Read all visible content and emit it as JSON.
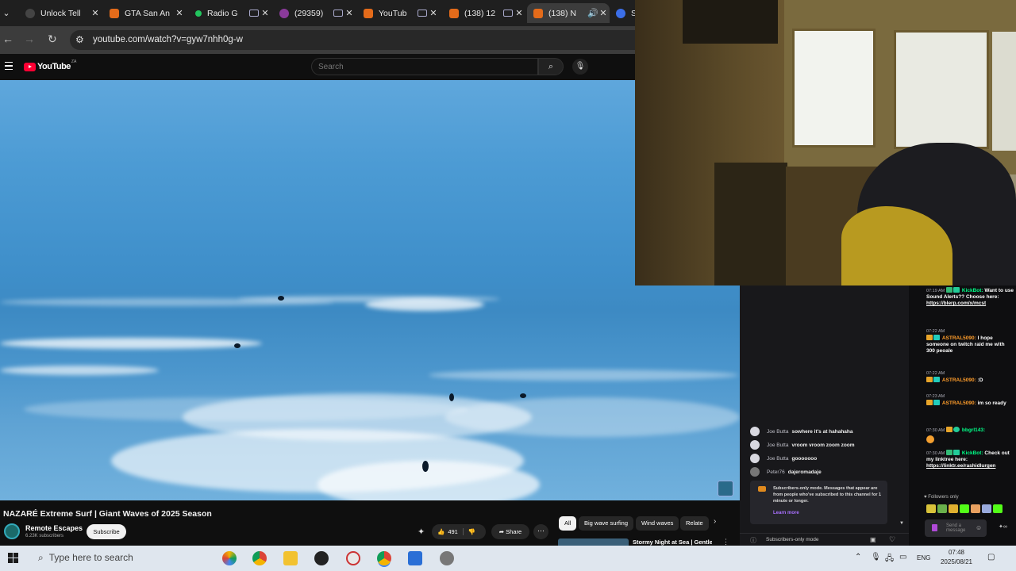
{
  "browser": {
    "tabs": [
      {
        "label": "Unlock Tell",
        "favicon": "circle-dark",
        "active": false
      },
      {
        "label": "GTA San An",
        "favicon": "youtube",
        "active": false
      },
      {
        "label": "Radio G",
        "favicon": "green-dot",
        "active": false
      },
      {
        "label": "(29359)",
        "favicon": "avatar",
        "active": false
      },
      {
        "label": "YouTub",
        "favicon": "youtube",
        "active": false
      },
      {
        "label": "(138) 12",
        "favicon": "youtube",
        "active": false
      },
      {
        "label": "(138) N",
        "favicon": "youtube",
        "active": true
      },
      {
        "label": "S",
        "favicon": "blue-x",
        "active": false
      }
    ],
    "url": "youtube.com/watch?v=gyw7nhh0g-w"
  },
  "youtube": {
    "logo_text": "YouTube",
    "country_code": "ZA",
    "search_placeholder": "Search",
    "video": {
      "title": "NAZARÉ Extreme Surf | Giant Waves of 2025 Season",
      "channel": "Remote Escapes",
      "subscribers": "6.23K subscribers",
      "subscribe_label": "Subscribe",
      "likes": "491",
      "share_label": "Share"
    },
    "chips": [
      "All",
      "Big wave surfing",
      "Wind waves",
      "Relate"
    ],
    "related": {
      "title": "Stormy Night at Sea | Gentle"
    }
  },
  "twitch_chat": {
    "messages": [
      {
        "user": "Joe Butta",
        "text": "sowhere it's at hahahaha"
      },
      {
        "user": "Joe Butta",
        "text": "vroom vroom zoom zoom"
      },
      {
        "user": "Joe Butta",
        "text": "gooooooo"
      },
      {
        "user": "Peter76",
        "text": "dajeromadaje"
      }
    ],
    "sub_mode_notice": "Subscribers-only mode. Messages that appear are from people who've subscribed to this channel for 1 minute or longer.",
    "learn_more": "Learn more",
    "sub_mode_label": "Subscribers-only mode"
  },
  "kick_chat": {
    "messages": [
      {
        "time": "07:19 AM",
        "user": "KickBot",
        "user_color": "#00ff88",
        "text": "Want to use Sound Alerts?? Choose here:",
        "link": "https://blerp.com/x/mcst"
      },
      {
        "time": "07:22 AM",
        "user": "ASTRAL5090",
        "user_color": "#ff9d2b",
        "text": "I hope someone on twitch raid me with 300 peoale",
        "link": ""
      },
      {
        "time": "07:22 AM",
        "user": "ASTRAL5090",
        "user_color": "#ff9d2b",
        "text": ":D",
        "link": ""
      },
      {
        "time": "07:23 AM",
        "user": "ASTRAL5090",
        "user_color": "#ff9d2b",
        "text": "im so ready",
        "link": ""
      },
      {
        "time": "07:30 AM",
        "user": "bbgrl143",
        "user_color": "#00ff88",
        "text": "",
        "link": ""
      },
      {
        "time": "07:30 AM",
        "user": "KickBot",
        "user_color": "#00ff88",
        "text": "Check out my linktree here:",
        "link": "https://linktr.ee/rashidlurgen"
      }
    ],
    "followers_only": "Followers only",
    "send_placeholder": "Send a message"
  },
  "taskbar": {
    "search_placeholder": "Type here to search",
    "language": "ENG",
    "time": "07:48",
    "date": "2025/08/21"
  }
}
